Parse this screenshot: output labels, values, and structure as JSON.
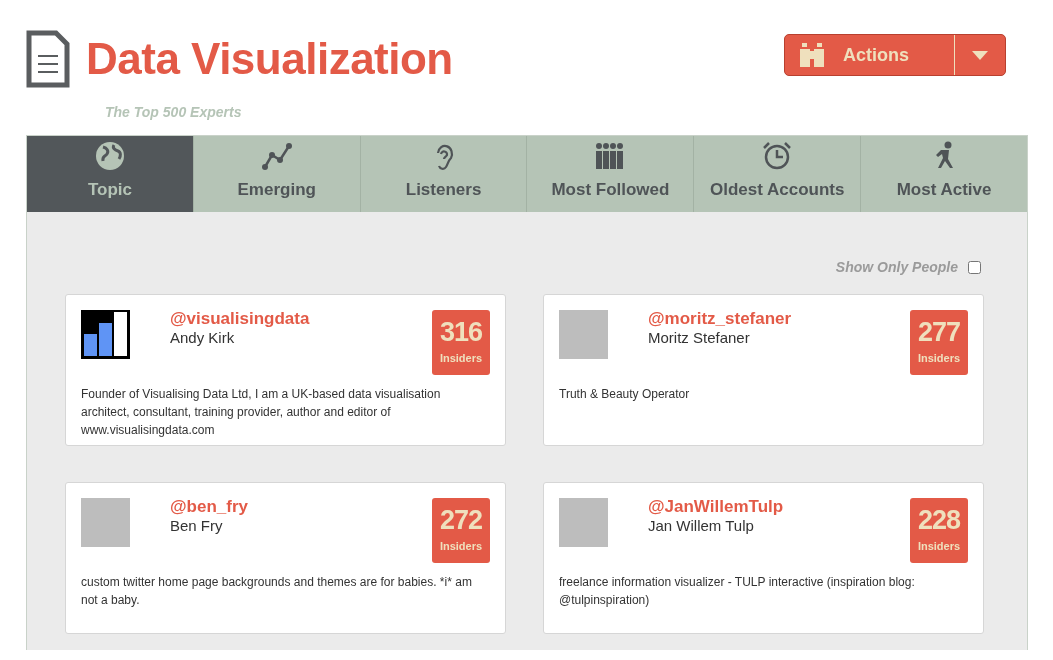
{
  "header": {
    "title": "Data Visualization",
    "subtitle": "The Top 500 Experts",
    "actions_button": "Actions"
  },
  "tabs": [
    {
      "label": "Topic",
      "selected": true
    },
    {
      "label": "Emerging",
      "selected": false
    },
    {
      "label": "Listeners",
      "selected": false
    },
    {
      "label": "Most Followed",
      "selected": false
    },
    {
      "label": "Oldest Accounts",
      "selected": false
    },
    {
      "label": "Most Active",
      "selected": false
    }
  ],
  "filter": {
    "label": "Show Only People",
    "checked": false
  },
  "experts": [
    {
      "handle": "@visualisingdata",
      "name": "Andy Kirk",
      "count": "316",
      "count_label": "Insiders",
      "kind": "logo",
      "bio": "Founder of Visualising Data Ltd, I am a UK-based data visualisation architect, consultant, training provider, author and editor of www.visualisingdata.com"
    },
    {
      "handle": "@moritz_stefaner",
      "name": "Moritz Stefaner",
      "count": "277",
      "count_label": "Insiders",
      "kind": "photo",
      "bio": "Truth & Beauty Operator"
    },
    {
      "handle": "@ben_fry",
      "name": "Ben Fry",
      "count": "272",
      "count_label": "Insiders",
      "kind": "photo",
      "bio": "custom twitter home page backgrounds and themes are for babies. *i* am not a baby."
    },
    {
      "handle": "@JanWillemTulp",
      "name": "Jan Willem Tulp",
      "count": "228",
      "count_label": "Insiders",
      "kind": "photo",
      "bio": "freelance information visualizer - TULP interactive (inspiration blog: @tulpinspiration)"
    }
  ]
}
